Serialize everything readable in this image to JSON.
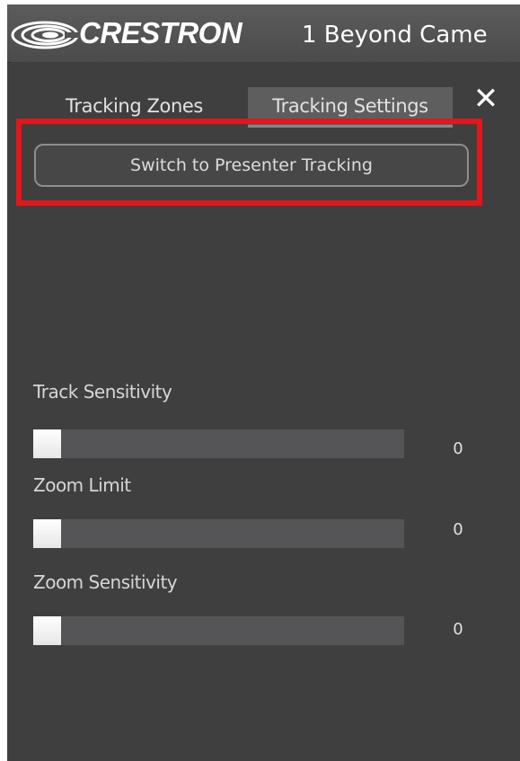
{
  "header": {
    "brand": "CRESTRON",
    "app_title": "1 Beyond Came",
    "logo": "crestron-swirl-icon"
  },
  "tabs": [
    {
      "label": "Tracking Zones",
      "active": false
    },
    {
      "label": "Tracking Settings",
      "active": true
    }
  ],
  "close_icon": "close-icon",
  "close_glyph": "✕",
  "switch_button": {
    "label": "Switch to Presenter Tracking"
  },
  "highlight_color": "#e4161b",
  "sliders": [
    {
      "label": "Track Sensitivity",
      "value": "0",
      "level": 0
    },
    {
      "label": "Zoom Limit",
      "value": "0",
      "level": 0
    },
    {
      "label": "Zoom Sensitivity",
      "value": "0",
      "level": 0
    }
  ]
}
